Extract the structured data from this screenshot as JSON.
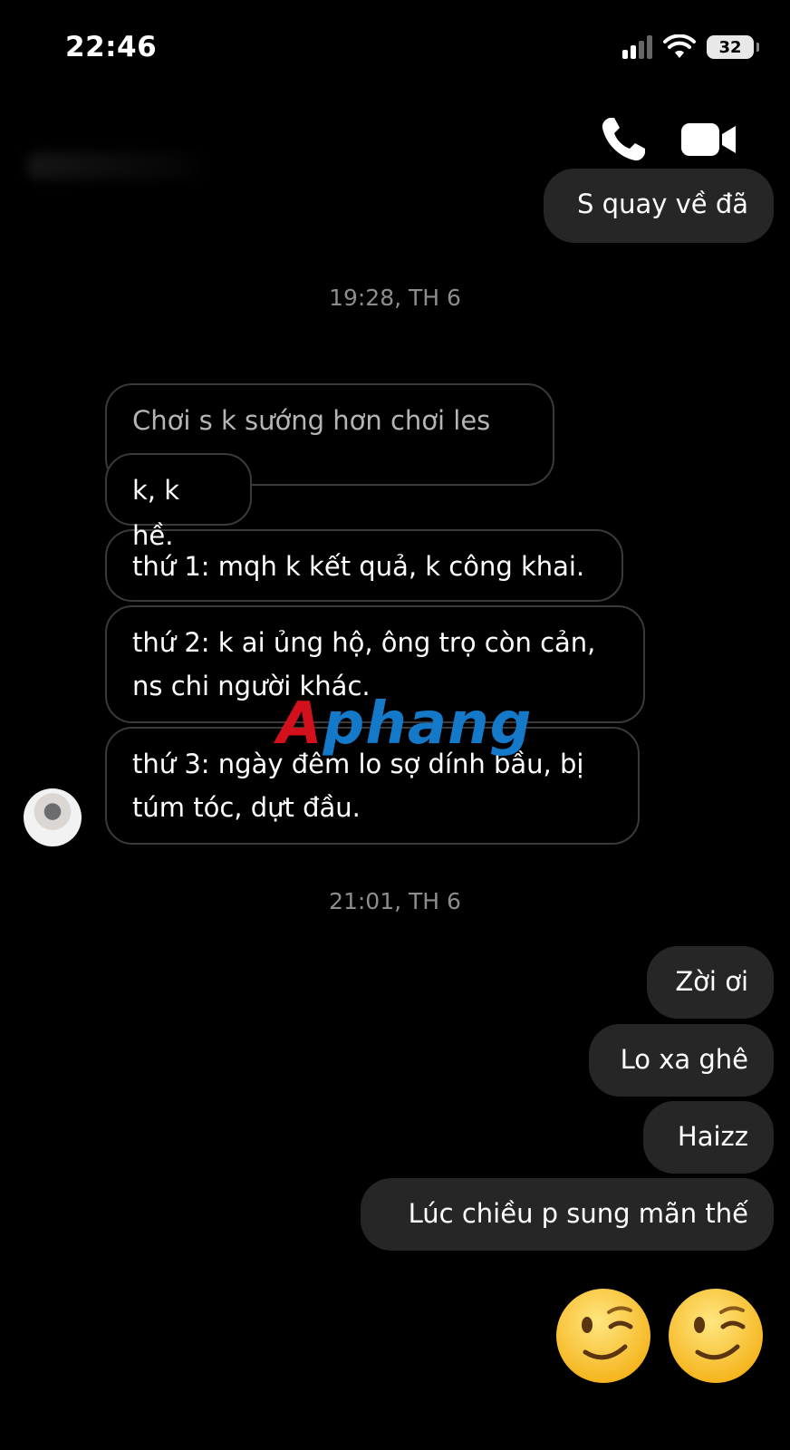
{
  "status_bar": {
    "time": "22:46",
    "battery": "32"
  },
  "messages": {
    "top_out": "S quay về đã",
    "timestamp_1": "19:28, TH 6",
    "in_quote": "Chơi s k sướng hơn chơi les sao",
    "in_1": "k, k hề.",
    "in_2": "thứ 1: mqh k kết quả, k công khai.",
    "in_3_line1": "thứ 2: k ai ủng hộ, ông trọ còn cản,",
    "in_3_line2": "ns chi người khác.",
    "in_4_line1": "thứ 3: ngày đêm lo sợ dính bầu, bị",
    "in_4_line2": "túm tóc, dựt đầu.",
    "timestamp_2": "21:01, TH 6",
    "out_1": "Zời ơi",
    "out_2": "Lo xa ghê",
    "out_3": "Haizz",
    "out_4": "Lúc chiều p sung mãn thế"
  },
  "watermark": {
    "part1": "A",
    "part2": "phang"
  },
  "emojis": [
    "winking-face",
    "winking-face"
  ],
  "icons": {
    "call": "phone-icon",
    "video": "video-camera-icon"
  },
  "colors": {
    "outgoing_bubble": "#262626",
    "incoming_border": "#3a3a3a",
    "timestamp": "#8d8d8d"
  }
}
